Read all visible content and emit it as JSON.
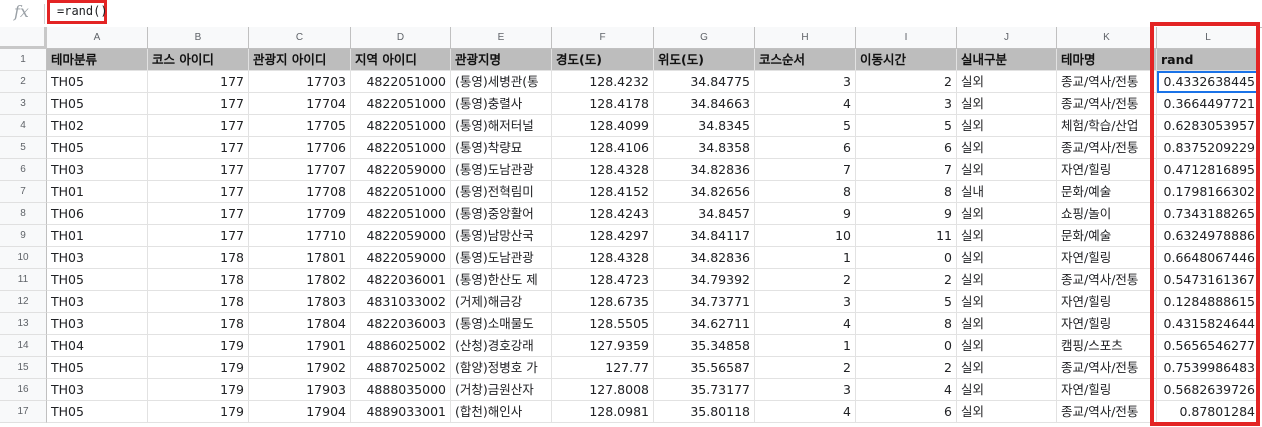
{
  "formula_bar": {
    "icon": "fx-icon",
    "label": "fx",
    "formula": "=rand()"
  },
  "columns": [
    "A",
    "B",
    "C",
    "D",
    "E",
    "F",
    "G",
    "H",
    "I",
    "J",
    "K",
    "L"
  ],
  "header_row": [
    "테마분류",
    "코스 아이디",
    "관광지 아이디",
    "지역 아이디",
    "관광지명",
    "경도(도)",
    "위도(도)",
    "코스순서",
    "이동시간",
    "실내구분",
    "테마명",
    "rand"
  ],
  "rows": [
    [
      "TH05",
      "177",
      "17703",
      "4822051000",
      "(통영)세병관(통",
      "128.4232",
      "34.84775",
      "3",
      "2",
      "실외",
      "종교/역사/전통",
      "0.4332638445"
    ],
    [
      "TH05",
      "177",
      "17704",
      "4822051000",
      "(통영)충렬사",
      "128.4178",
      "34.84663",
      "4",
      "3",
      "실외",
      "종교/역사/전통",
      "0.3664497721"
    ],
    [
      "TH02",
      "177",
      "17705",
      "4822051000",
      "(통영)해저터널",
      "128.4099",
      "34.8345",
      "5",
      "5",
      "실외",
      "체험/학습/산업",
      "0.6283053957"
    ],
    [
      "TH05",
      "177",
      "17706",
      "4822051000",
      "(통영)착량묘",
      "128.4106",
      "34.8358",
      "6",
      "6",
      "실외",
      "종교/역사/전통",
      "0.8375209229"
    ],
    [
      "TH03",
      "177",
      "17707",
      "4822059000",
      "(통영)도남관광",
      "128.4328",
      "34.82836",
      "7",
      "7",
      "실외",
      "자연/힐링",
      "0.4712816895"
    ],
    [
      "TH01",
      "177",
      "17708",
      "4822051000",
      "(통영)전혁림미",
      "128.4152",
      "34.82656",
      "8",
      "8",
      "실내",
      "문화/예술",
      "0.1798166302"
    ],
    [
      "TH06",
      "177",
      "17709",
      "4822051000",
      "(통영)중앙활어",
      "128.4243",
      "34.8457",
      "9",
      "9",
      "실외",
      "쇼핑/놀이",
      "0.7343188265"
    ],
    [
      "TH01",
      "177",
      "17710",
      "4822059000",
      "(통영)남망산국",
      "128.4297",
      "34.84117",
      "10",
      "11",
      "실외",
      "문화/예술",
      "0.6324978886"
    ],
    [
      "TH03",
      "178",
      "17801",
      "4822059000",
      "(통영)도남관광",
      "128.4328",
      "34.82836",
      "1",
      "0",
      "실외",
      "자연/힐링",
      "0.6648067446"
    ],
    [
      "TH05",
      "178",
      "17802",
      "4822036001",
      "(통영)한산도 제",
      "128.4723",
      "34.79392",
      "2",
      "2",
      "실외",
      "종교/역사/전통",
      "0.5473161367"
    ],
    [
      "TH03",
      "178",
      "17803",
      "4831033002",
      "(거제)해금강",
      "128.6735",
      "34.73771",
      "3",
      "5",
      "실외",
      "자연/힐링",
      "0.1284888615"
    ],
    [
      "TH03",
      "178",
      "17804",
      "4822036003",
      "(통영)소매물도",
      "128.5505",
      "34.62711",
      "4",
      "8",
      "실외",
      "자연/힐링",
      "0.4315824644"
    ],
    [
      "TH04",
      "179",
      "17901",
      "4886025002",
      "(산청)경호강래",
      "127.9359",
      "35.34858",
      "1",
      "0",
      "실외",
      "캠핑/스포츠",
      "0.5656546277"
    ],
    [
      "TH05",
      "179",
      "17902",
      "4887025002",
      "(함양)정병호 가",
      "127.77",
      "35.56587",
      "2",
      "2",
      "실외",
      "종교/역사/전통",
      "0.7539986483"
    ],
    [
      "TH03",
      "179",
      "17903",
      "4888035000",
      "(거창)금원산자",
      "127.8008",
      "35.73177",
      "3",
      "4",
      "실외",
      "자연/힐링",
      "0.5682639726"
    ],
    [
      "TH05",
      "179",
      "17904",
      "4889033001",
      "(합천)해인사",
      "128.0981",
      "35.80118",
      "4",
      "6",
      "실외",
      "종교/역사/전통",
      "0.87801284"
    ]
  ]
}
